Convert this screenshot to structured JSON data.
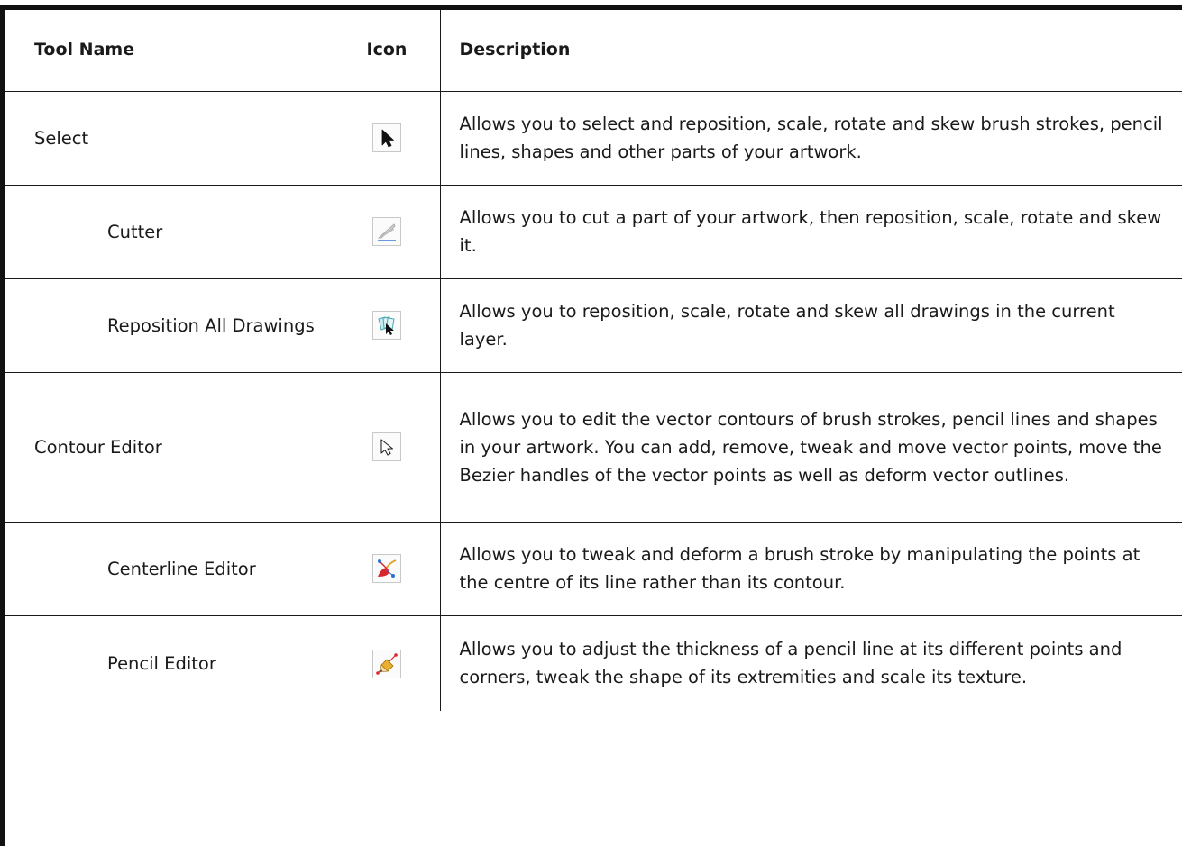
{
  "table": {
    "headers": {
      "name": "Tool Name",
      "icon": "Icon",
      "description": "Description"
    },
    "rows": [
      {
        "name": "Select",
        "icon": "select-arrow-icon",
        "description": "Allows you to select and reposition, scale, rotate and skew brush strokes, pencil lines, shapes and other parts of your artwork."
      },
      {
        "name": "Cutter",
        "icon": "cutter-icon",
        "description": "Allows you to cut a part of your artwork, then reposition, scale, rotate and skew it."
      },
      {
        "name": "Reposition All Drawings",
        "icon": "reposition-all-drawings-icon",
        "description": "Allows you to reposition, scale, rotate and skew all drawings in the current layer."
      },
      {
        "name": "Contour Editor",
        "icon": "contour-editor-icon",
        "description": "Allows you to edit the vector contours of brush strokes, pencil lines and shapes in your artwork. You can add, remove, tweak and move vector points, move the Bezier handles of the vector points as well as deform vector outlines."
      },
      {
        "name": "Centerline Editor",
        "icon": "centerline-editor-icon",
        "description": "Allows you to tweak and deform a brush stroke by manipulating the points at the centre of its line rather than its contour."
      },
      {
        "name": "Pencil Editor",
        "icon": "pencil-editor-icon",
        "description": "Allows you to adjust the thickness of a pencil line at its different points and corners, tweak the shape of its extremities and scale its texture."
      }
    ]
  }
}
